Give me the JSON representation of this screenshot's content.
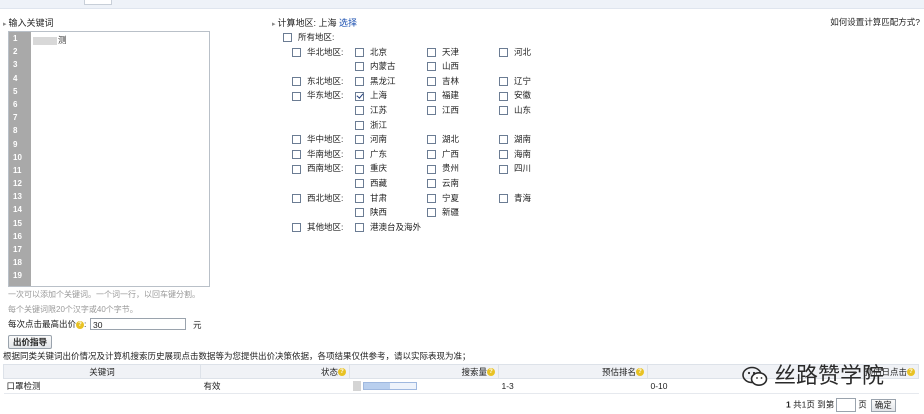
{
  "header": {
    "keyword_title": "输入关键词",
    "region_label": "计算地区: 上海",
    "region_link": "选择",
    "help_link": "如何设置计算匹配方式?"
  },
  "editor": {
    "line_numbers": [
      "1",
      "2",
      "3",
      "4",
      "5",
      "6",
      "7",
      "8",
      "9",
      "10",
      "11",
      "12",
      "13",
      "14",
      "15",
      "16",
      "17",
      "18",
      "19"
    ],
    "keyword_suffix": "测"
  },
  "hints": [
    "一次可以添加个关键词。一个词一行，以回车键分割。",
    "每个关键词限20个汉字或40个字节。"
  ],
  "bid": {
    "label": "每次点击最高出价",
    "value": "30",
    "unit": "元"
  },
  "bid_button": "出价指导",
  "note": "根据同类关键词出价情况及计算机搜索历史展现点击数据等为您提供出价决策依据，各项结果仅供参考，请以实际表现为准；",
  "regions": {
    "all_label": "所有地区:",
    "groups": [
      {
        "label": "华北地区:",
        "items": [
          "北京",
          "天津",
          "河北",
          "内蒙古",
          "山西"
        ]
      },
      {
        "label": "东北地区:",
        "items": [
          "黑龙江",
          "吉林",
          "辽宁"
        ]
      },
      {
        "label": "华东地区:",
        "items": [
          "上海",
          "福建",
          "安徽",
          "江苏",
          "江西",
          "山东",
          "浙江"
        ]
      },
      {
        "label": "华中地区:",
        "items": [
          "河南",
          "湖北",
          "湖南"
        ]
      },
      {
        "label": "华南地区:",
        "items": [
          "广东",
          "广西",
          "海南"
        ]
      },
      {
        "label": "西南地区:",
        "items": [
          "重庆",
          "贵州",
          "四川",
          "西藏",
          "云南"
        ]
      },
      {
        "label": "西北地区:",
        "items": [
          "甘肃",
          "宁夏",
          "青海",
          "陕西",
          "新疆"
        ]
      },
      {
        "label": "其他地区:",
        "items": [
          "港澳台及海外"
        ]
      }
    ],
    "checked": [
      "上海"
    ]
  },
  "table": {
    "headers": [
      "关键词",
      "状态",
      "搜索量",
      "预估排名",
      "预估日点击"
    ],
    "row": {
      "keyword": "口罩检测",
      "status": "有效",
      "search_volume_level": 0.5,
      "rank": "1-3",
      "clicks": "0-10"
    }
  },
  "pager": {
    "current": "1",
    "total": "共1页",
    "goto": "到第",
    "page_unit": "页",
    "confirm": "确定"
  },
  "watermark": {
    "text": "丝路赞学院",
    "icon": "wechat-icon"
  }
}
